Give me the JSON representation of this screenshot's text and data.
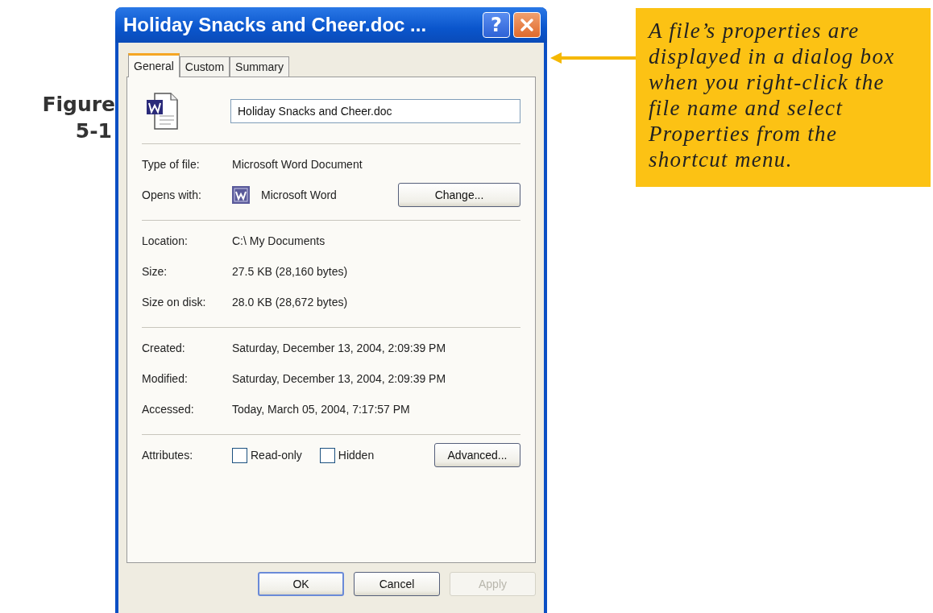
{
  "figure_label": {
    "line_1": "Figure",
    "line_2": "5-1"
  },
  "window": {
    "title": "Holiday Snacks and Cheer.doc ...",
    "help_button": "?"
  },
  "tabs": [
    {
      "label": "General",
      "selected": true
    },
    {
      "label": "Custom",
      "selected": false
    },
    {
      "label": "Summary",
      "selected": false
    }
  ],
  "file_name_field": {
    "value": "Holiday Snacks and Cheer.doc"
  },
  "sections": [
    [
      {
        "kind": "text",
        "label": "Type of file:",
        "value": "Microsoft Word Document"
      },
      {
        "kind": "app",
        "label": "Opens with:",
        "value": "Microsoft Word",
        "button": "Change..."
      }
    ],
    [
      {
        "kind": "text",
        "label": "Location:",
        "value": "C:\\ My Documents"
      },
      {
        "kind": "text",
        "label": "Size:",
        "value": "27.5 KB (28,160 bytes)"
      },
      {
        "kind": "text",
        "label": "Size on disk:",
        "value": "28.0 KB (28,672 bytes)"
      }
    ],
    [
      {
        "kind": "text",
        "label": "Created:",
        "value": "Saturday, December 13, 2004, 2:09:39 PM"
      },
      {
        "kind": "text",
        "label": "Modified:",
        "value": "Saturday, December 13, 2004, 2:09:39 PM"
      },
      {
        "kind": "text",
        "label": "Accessed:",
        "value": "Today, March 05, 2004, 7:17:57 PM"
      }
    ],
    [
      {
        "kind": "attributes",
        "label": "Attributes:",
        "checkboxes": [
          {
            "label": "Read-only",
            "checked": false
          },
          {
            "label": "Hidden",
            "checked": false
          }
        ],
        "button": "Advanced..."
      }
    ]
  ],
  "buttons": [
    {
      "label": "OK",
      "disabled": false
    },
    {
      "label": "Cancel",
      "disabled": false
    },
    {
      "label": "Apply",
      "disabled": true
    }
  ],
  "callout": {
    "text": "A file’s properties are displayed in a dialog box when you right-click the file name and select Properties from the shortcut menu."
  }
}
